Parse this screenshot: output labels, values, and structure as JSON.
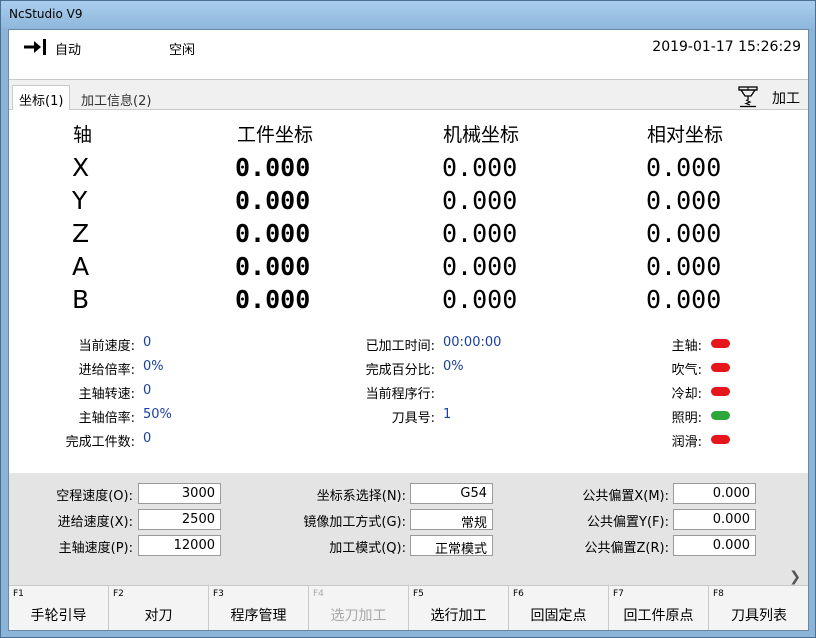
{
  "window": {
    "title": "NcStudio V9"
  },
  "status": {
    "mode": "自动",
    "state": "空闲",
    "datetime": "2019-01-17 15:26:29"
  },
  "tabs": [
    {
      "label": "坐标(1)"
    },
    {
      "label": "加工信息(2)"
    }
  ],
  "machine_label": "加工",
  "coords": {
    "headers": {
      "axis": "轴",
      "work": "工件坐标",
      "machine": "机械坐标",
      "relative": "相对坐标"
    },
    "rows": [
      {
        "axis": "X",
        "work": "0.000",
        "machine": "0.000",
        "relative": "0.000"
      },
      {
        "axis": "Y",
        "work": "0.000",
        "machine": "0.000",
        "relative": "0.000"
      },
      {
        "axis": "Z",
        "work": "0.000",
        "machine": "0.000",
        "relative": "0.000"
      },
      {
        "axis": "A",
        "work": "0.000",
        "machine": "0.000",
        "relative": "0.000"
      },
      {
        "axis": "B",
        "work": "0.000",
        "machine": "0.000",
        "relative": "0.000"
      }
    ]
  },
  "info": {
    "left": [
      {
        "label": "当前速度:",
        "value": "0"
      },
      {
        "label": "进给倍率:",
        "value": "0%"
      },
      {
        "label": "主轴转速:",
        "value": "0"
      },
      {
        "label": "主轴倍率:",
        "value": "50%"
      },
      {
        "label": "完成工件数:",
        "value": "0"
      }
    ],
    "middle": [
      {
        "label": "已加工时间:",
        "value": "00:00:00"
      },
      {
        "label": "完成百分比:",
        "value": "0%"
      },
      {
        "label": "当前程序行:",
        "value": ""
      },
      {
        "label": "刀具号:",
        "value": "1"
      }
    ],
    "indicators": [
      {
        "label": "主轴:",
        "color": "#e8141c"
      },
      {
        "label": "吹气:",
        "color": "#e8141c"
      },
      {
        "label": "冷却:",
        "color": "#e8141c"
      },
      {
        "label": "照明:",
        "color": "#2ca83a"
      },
      {
        "label": "润滑:",
        "color": "#e8141c"
      }
    ]
  },
  "params": {
    "col1": [
      {
        "label": "空程速度(O):",
        "value": "3000"
      },
      {
        "label": "进给速度(X):",
        "value": "2500"
      },
      {
        "label": "主轴速度(P):",
        "value": "12000"
      }
    ],
    "col2": [
      {
        "label": "坐标系选择(N):",
        "value": "G54"
      },
      {
        "label": "镜像加工方式(G):",
        "value": "常规"
      },
      {
        "label": "加工模式(Q):",
        "value": "正常模式"
      }
    ],
    "col3": [
      {
        "label": "公共偏置X(M):",
        "value": "0.000"
      },
      {
        "label": "公共偏置Y(F):",
        "value": "0.000"
      },
      {
        "label": "公共偏置Z(R):",
        "value": "0.000"
      }
    ]
  },
  "fkeys": [
    {
      "key": "F1",
      "label": "手轮引导",
      "enabled": true
    },
    {
      "key": "F2",
      "label": "对刀",
      "enabled": true
    },
    {
      "key": "F3",
      "label": "程序管理",
      "enabled": true
    },
    {
      "key": "F4",
      "label": "选刀加工",
      "enabled": false
    },
    {
      "key": "F5",
      "label": "选行加工",
      "enabled": true
    },
    {
      "key": "F6",
      "label": "回固定点",
      "enabled": true
    },
    {
      "key": "F7",
      "label": "回工件原点",
      "enabled": true
    },
    {
      "key": "F8",
      "label": "刀具列表",
      "enabled": true
    }
  ]
}
